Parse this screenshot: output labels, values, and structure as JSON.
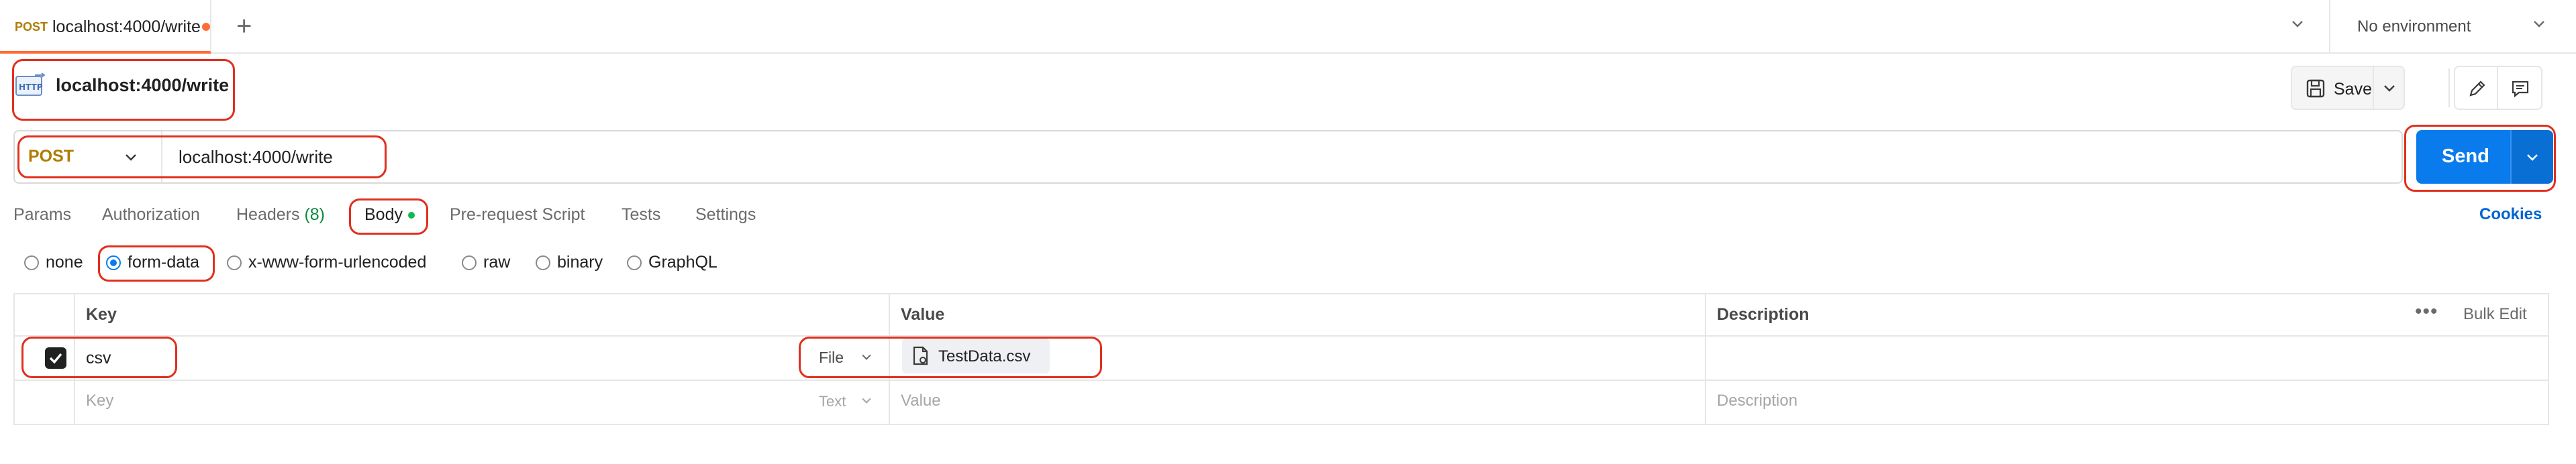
{
  "tab": {
    "method": "POST",
    "url": "localhost:4000/write"
  },
  "environment": {
    "label": "No environment"
  },
  "request": {
    "title": "localhost:4000/write",
    "save_label": "Save",
    "method": "POST",
    "url": "localhost:4000/write",
    "send_label": "Send"
  },
  "request_tabs": {
    "params": "Params",
    "authorization": "Authorization",
    "headers": "Headers",
    "headers_count": "(8)",
    "body": "Body",
    "pre_request": "Pre-request Script",
    "tests": "Tests",
    "settings": "Settings",
    "cookies": "Cookies"
  },
  "body_types": {
    "none": "none",
    "form_data": "form-data",
    "urlencoded": "x-www-form-urlencoded",
    "raw": "raw",
    "binary": "binary",
    "graphql": "GraphQL",
    "selected": "form-data"
  },
  "table": {
    "headers": {
      "key": "Key",
      "value": "Value",
      "description": "Description",
      "bulk_edit": "Bulk Edit"
    },
    "rows": [
      {
        "checked": true,
        "key": "csv",
        "type": "File",
        "value": "TestData.csv",
        "description": ""
      }
    ],
    "placeholder": {
      "key": "Key",
      "type": "Text",
      "value": "Value",
      "description": "Description"
    }
  },
  "colors": {
    "accent": "#097bed",
    "method": "#b07b00",
    "highlight": "#e0301e",
    "tab_indicator": "#ff6c37"
  }
}
